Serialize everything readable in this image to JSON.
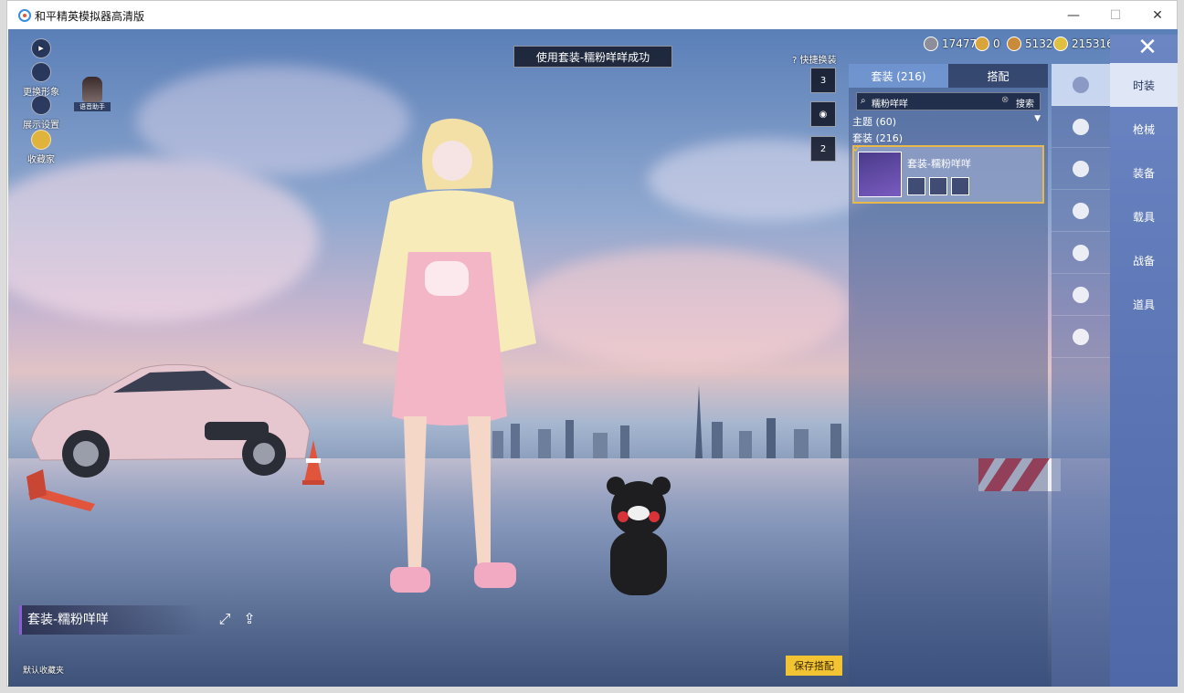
{
  "window": {
    "title": "和平精英模拟器高清版",
    "controls": {
      "minimize": "—",
      "maximize": "☐",
      "close": "✕"
    }
  },
  "left_toolbar": [
    {
      "label": "",
      "icon": "play-icon"
    },
    {
      "label": "更换形象",
      "icon": "avatar-icon"
    },
    {
      "label": "展示设置",
      "icon": "eye-icon"
    },
    {
      "label": "收藏家",
      "icon": "badge-icon"
    }
  ],
  "voice_assistant": "语音助手",
  "toast": "使用套装-糯粉咩咩成功",
  "currency": [
    {
      "value": "17477",
      "color": "#8e8e9a"
    },
    {
      "value": "0",
      "color": "#d9a43a"
    },
    {
      "value": "5132",
      "color": "#c98b3a"
    },
    {
      "value": "215316",
      "color": "#e0c040"
    }
  ],
  "quick_change": {
    "label": "快捷换装",
    "slots": [
      "3",
      "",
      "2"
    ]
  },
  "panel": {
    "tabs": [
      "套装 (216)",
      "搭配"
    ],
    "search_value": "糯粉咩咩",
    "search_button": "搜索",
    "theme_label": "主题 (60)",
    "set_label": "套装 (216)",
    "card_name": "套装-糯粉咩咩"
  },
  "categories": [
    "outfit-icon",
    "hat-icon",
    "glasses-icon",
    "face-icon",
    "top-icon",
    "pants-icon",
    "shoes-icon"
  ],
  "sidebar": [
    "时装",
    "枪械",
    "装备",
    "载具",
    "战备",
    "道具"
  ],
  "outfit_name": "套装-糯粉咩咩",
  "default_fav": "默认收藏夹",
  "save_button": "保存搭配",
  "colors": {
    "accent_gold": "#f2c433",
    "accent_purple": "#8b5ed8"
  }
}
